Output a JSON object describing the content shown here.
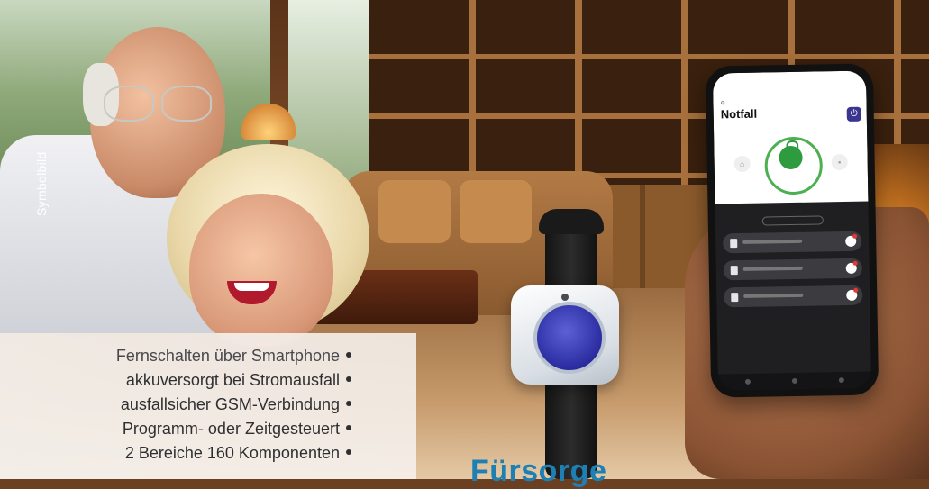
{
  "image_label": "Symbolbild",
  "features": [
    "Fernschalten über Smartphone",
    "akkuversorgt bei Stromausfall",
    "ausfallsicher GSM-Verbindung",
    "Programm- oder Zeitgesteuert",
    "2 Bereiche 160 Komponenten"
  ],
  "headline": "Fürsorge",
  "phone_app": {
    "title": "Notfall",
    "power_icon": "power-icon",
    "status_icon": "unlock-icon"
  },
  "colors": {
    "headline": "#1e7fb3",
    "panic_button": "#2a2ca0",
    "app_accent": "#3b3591",
    "status_green": "#2e9c3e"
  }
}
